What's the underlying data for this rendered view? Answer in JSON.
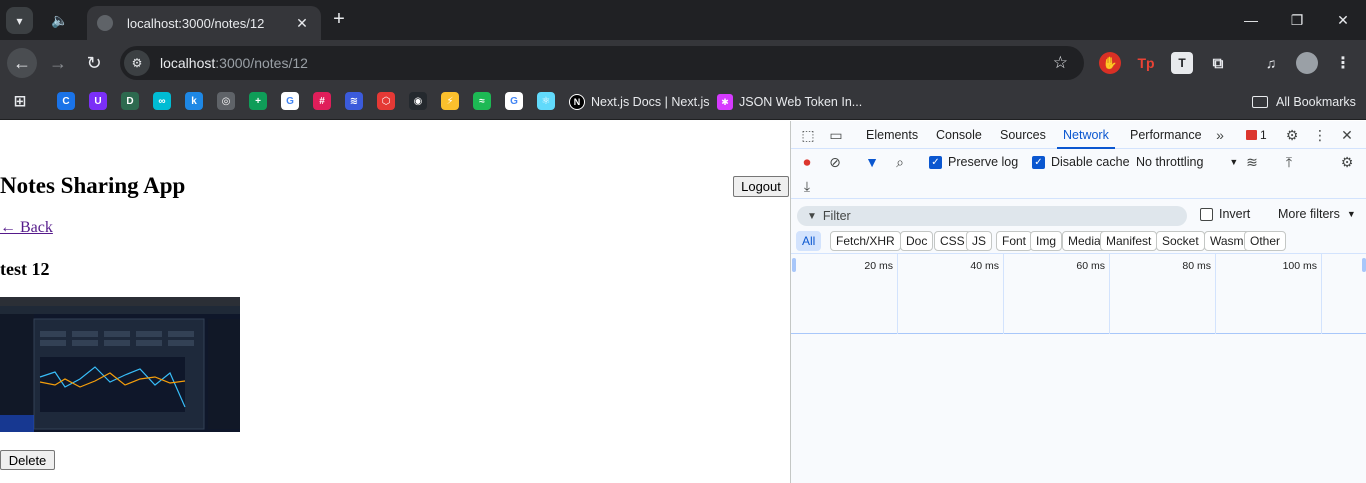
{
  "browser": {
    "tab_title": "localhost:3000/notes/12",
    "url_host": "localhost",
    "url_path": ":3000/notes/12",
    "bookmarks": [
      {
        "icon": "c-icon",
        "color": "#1a73e8",
        "glyph": "C"
      },
      {
        "icon": "u-icon",
        "color": "#7b2ff7",
        "glyph": "U"
      },
      {
        "icon": "dev-icon",
        "color": "#2d6a4f",
        "glyph": "D"
      },
      {
        "icon": "infinity-icon",
        "color": "#00bcd4",
        "glyph": "∞"
      },
      {
        "icon": "k-icon",
        "color": "#1e88e5",
        "glyph": "k"
      },
      {
        "icon": "chrome-gray-icon",
        "color": "#5f6368",
        "glyph": "◎"
      },
      {
        "icon": "sheets-icon",
        "color": "#0f9d58",
        "glyph": "+"
      },
      {
        "icon": "google-icon",
        "color": "#ffffff",
        "glyph": "G"
      },
      {
        "icon": "slack-icon",
        "color": "#e01e5a",
        "glyph": "#"
      },
      {
        "icon": "lines-icon",
        "color": "#3b5bdb",
        "glyph": "≋"
      },
      {
        "icon": "hex-icon",
        "color": "#e53935",
        "glyph": "⬡"
      },
      {
        "icon": "github-icon",
        "color": "#24292e",
        "glyph": "◉"
      },
      {
        "icon": "bolt-icon",
        "color": "#fbc02d",
        "glyph": "⚡"
      },
      {
        "icon": "spotify-icon",
        "color": "#1db954",
        "glyph": "≈"
      },
      {
        "icon": "google-icon-2",
        "color": "#ffffff",
        "glyph": "G"
      },
      {
        "icon": "react-icon",
        "color": "#61dafb",
        "glyph": "⚛"
      }
    ],
    "bookmark_nextjs": "Next.js Docs | Next.js",
    "bookmark_jwt": "JSON Web Token In...",
    "all_bookmarks": "All Bookmarks"
  },
  "page": {
    "app_title": "Notes Sharing App",
    "logout_label": "Logout",
    "back_label": "← Back",
    "note_title": "test 12",
    "delete_label": "Delete"
  },
  "devtools": {
    "tabs": [
      "Elements",
      "Console",
      "Sources",
      "Network",
      "Performance"
    ],
    "active_tab": "Network",
    "error_count": "1",
    "preserve_log": "Preserve log",
    "disable_cache": "Disable cache",
    "throttling": "No throttling",
    "filter_placeholder": "Filter",
    "invert": "Invert",
    "more_filters": "More filters",
    "type_chips": [
      "All",
      "Fetch/XHR",
      "Doc",
      "CSS",
      "JS",
      "Font",
      "Img",
      "Media",
      "Manifest",
      "Socket",
      "Wasm",
      "Other"
    ],
    "timeline_labels": [
      "20 ms",
      "40 ms",
      "60 ms",
      "80 ms",
      "100 ms"
    ]
  }
}
